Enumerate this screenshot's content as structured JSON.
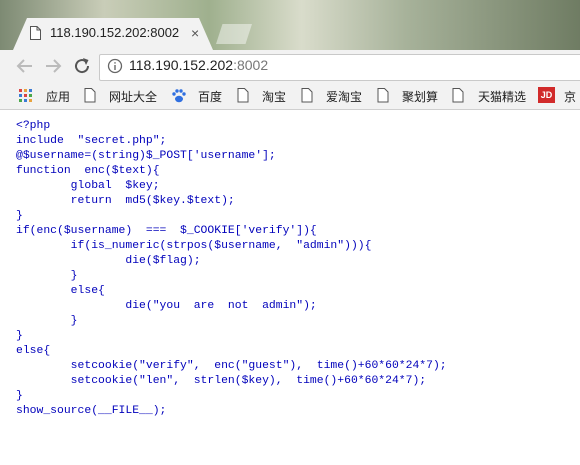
{
  "browser": {
    "tab": {
      "title": "118.190.152.202:8002",
      "close": "×"
    },
    "address": {
      "host": "118.190.152.202",
      "port": ":8002"
    },
    "bookmarks": [
      {
        "label": "应用",
        "icon": "apps-grid-icon"
      },
      {
        "label": "网址大全",
        "icon": "page-icon"
      },
      {
        "label": "百度",
        "icon": "baidu-paw-icon"
      },
      {
        "label": "淘宝",
        "icon": "page-icon"
      },
      {
        "label": "爱淘宝",
        "icon": "page-icon"
      },
      {
        "label": "聚划算",
        "icon": "page-icon"
      },
      {
        "label": "天猫精选",
        "icon": "page-icon"
      },
      {
        "label": "京",
        "icon": "jd-icon"
      }
    ],
    "jd_badge": "JD"
  },
  "source_lines": [
    "<?php",
    "include  \"secret.php\";",
    "@$username=(string)$_POST['username'];",
    "function  enc($text){",
    "        global  $key;",
    "        return  md5($key.$text);",
    "}",
    "if(enc($username)  ===  $_COOKIE['verify']){",
    "        if(is_numeric(strpos($username,  \"admin\"))){",
    "                die($flag);",
    "        }",
    "        else{",
    "                die(\"you  are  not  admin\");",
    "        }",
    "}",
    "else{",
    "        setcookie(\"verify\",  enc(\"guest\"),  time()+60*60*24*7);",
    "        setcookie(\"len\",  strlen($key),  time()+60*60*24*7);",
    "}",
    "show_source(__FILE__);"
  ],
  "colors": {
    "code": "#0000bb",
    "chrome_bg": "#f2f2f2"
  }
}
